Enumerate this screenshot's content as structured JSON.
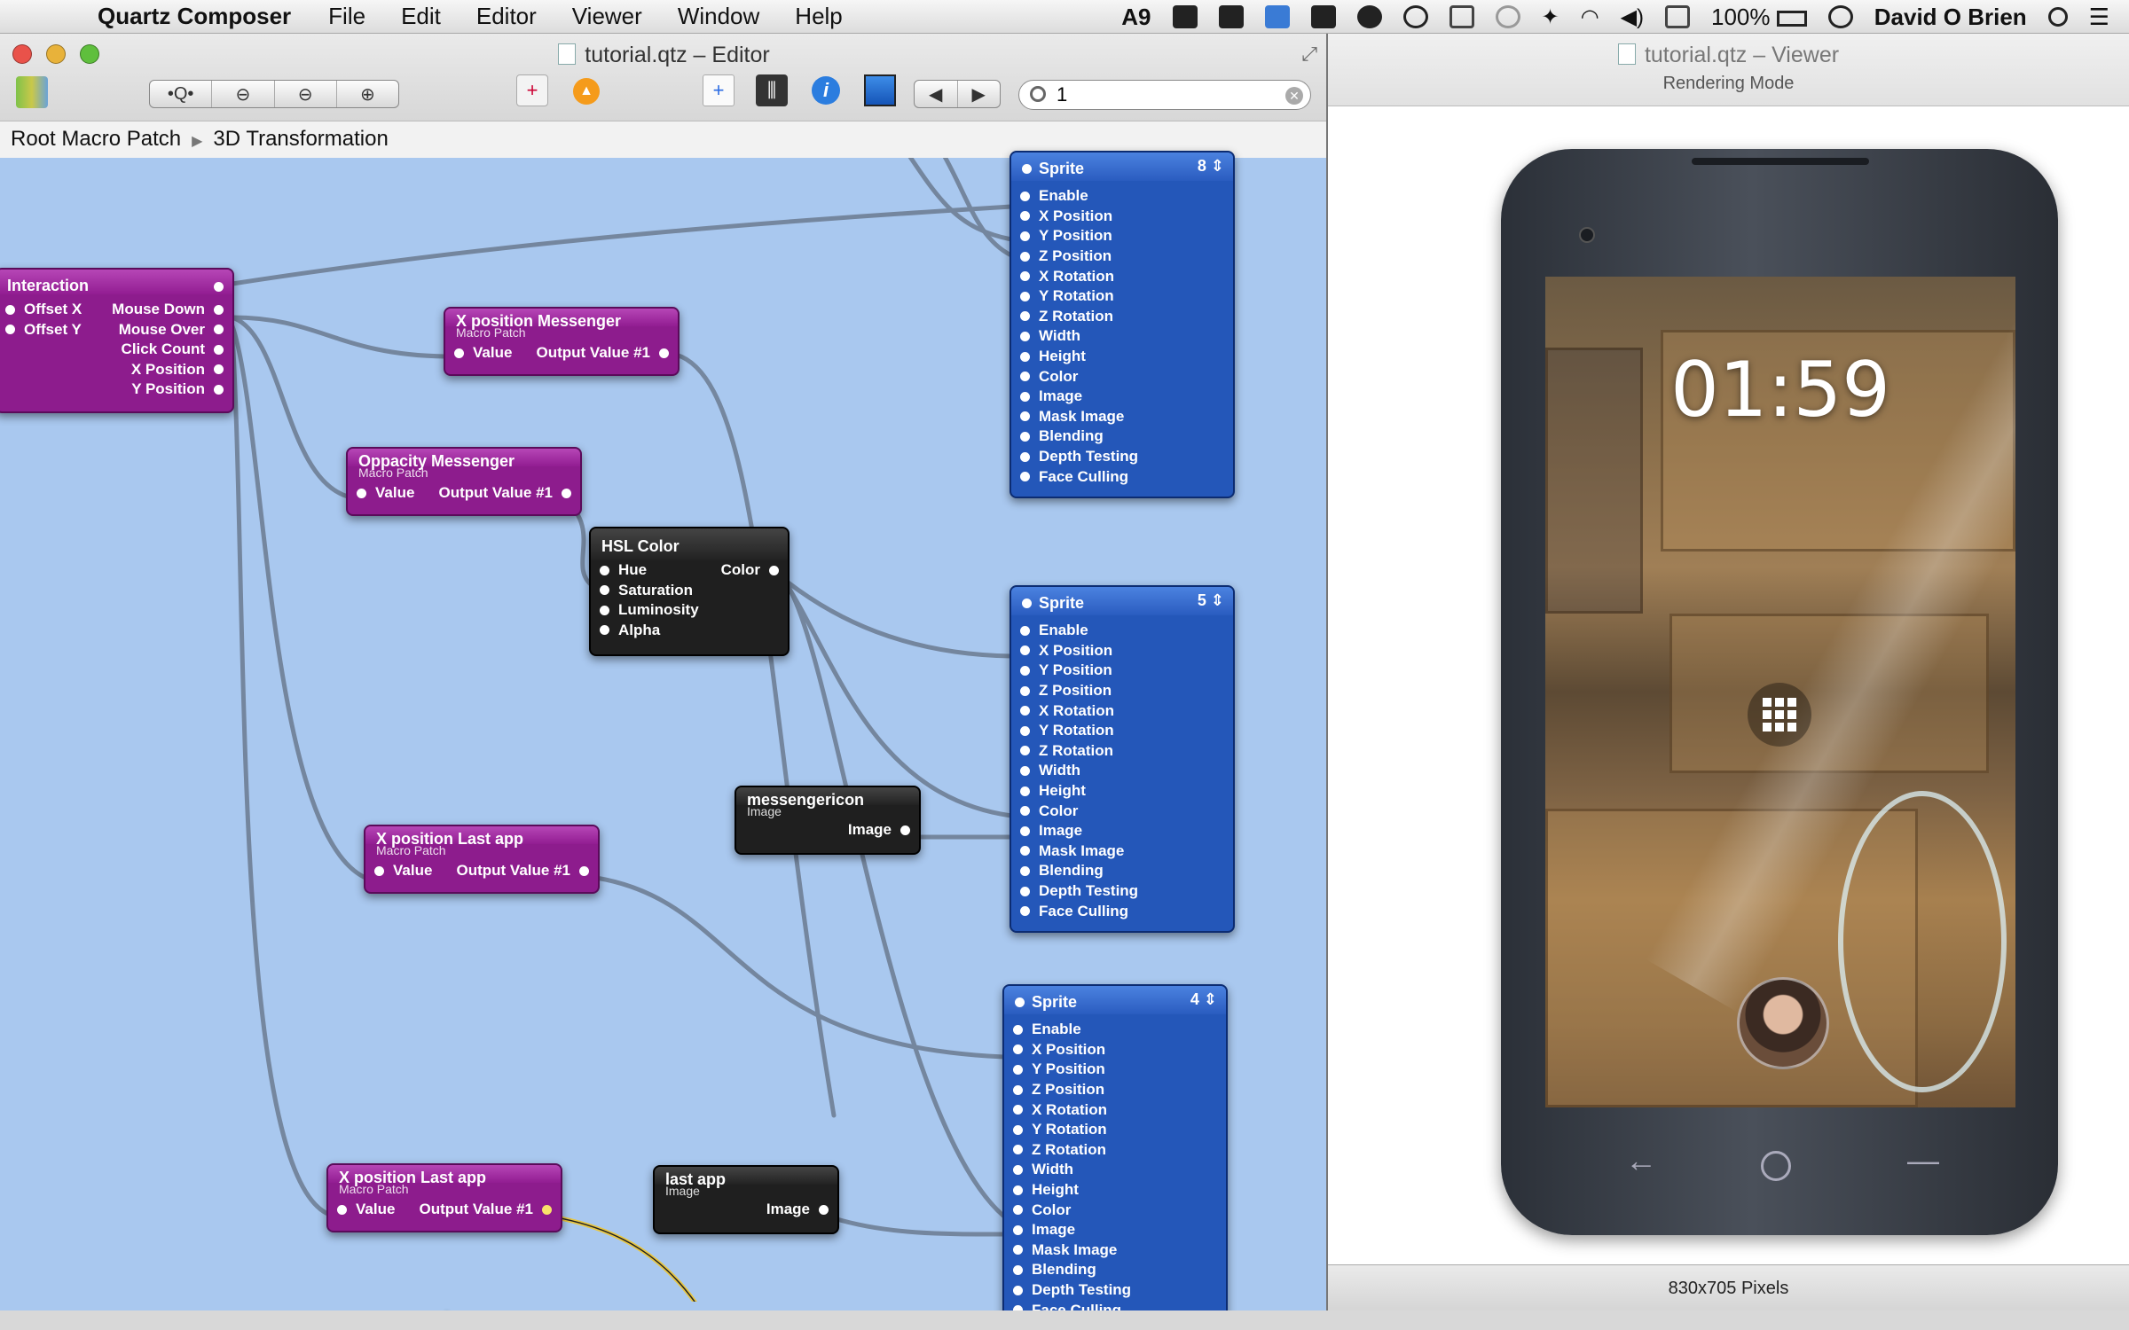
{
  "menubar": {
    "app_name": "Quartz Composer",
    "menus": [
      "File",
      "Edit",
      "Editor",
      "Viewer",
      "Window",
      "Help"
    ],
    "extras_text_1": "9",
    "battery": "100%",
    "user": "David O Brien"
  },
  "editor": {
    "title": "tutorial.qtz – Editor",
    "search_value": "1",
    "breadcrumb": [
      "Root Macro Patch",
      "3D Transformation"
    ]
  },
  "patches": {
    "interaction": {
      "title": "Interaction",
      "inputs": [
        "Offset X",
        "Offset Y"
      ],
      "outputs": [
        "Mouse Down",
        "Mouse Over",
        "Click Count",
        "X Position",
        "Y Position"
      ]
    },
    "xpos_messenger": {
      "title": "X position  Messenger",
      "subtitle": "Macro Patch",
      "input": "Value",
      "output": "Output Value #1"
    },
    "opacity_messenger": {
      "title": "Oppacity  Messenger",
      "subtitle": "Macro Patch",
      "input": "Value",
      "output": "Output Value #1"
    },
    "hsl_color": {
      "title": "HSL Color",
      "inputs": [
        "Hue",
        "Saturation",
        "Luminosity",
        "Alpha"
      ],
      "output": "Color"
    },
    "messenger_icon": {
      "title": "messengericon",
      "subtitle": "Image",
      "output": "Image"
    },
    "xpos_lastapp_1": {
      "title": "X position Last app",
      "subtitle": "Macro Patch",
      "input": "Value",
      "output": "Output Value #1"
    },
    "xpos_lastapp_2": {
      "title": "X position Last app",
      "subtitle": "Macro Patch",
      "input": "Value",
      "output": "Output Value #1"
    },
    "last_app": {
      "title": "last app",
      "subtitle": "Image",
      "output": "Image"
    },
    "sprite_ports": [
      "Enable",
      "X Position",
      "Y Position",
      "Z Position",
      "X Rotation",
      "Y Rotation",
      "Z Rotation",
      "Width",
      "Height",
      "Color",
      "Image",
      "Mask Image",
      "Blending",
      "Depth Testing",
      "Face Culling"
    ],
    "sprites": [
      {
        "title": "Sprite",
        "layer": "8"
      },
      {
        "title": "Sprite",
        "layer": "5"
      },
      {
        "title": "Sprite",
        "layer": "4"
      }
    ]
  },
  "viewer": {
    "title": "tutorial.qtz – Viewer",
    "mode": "Rendering Mode",
    "status": "830x705 Pixels",
    "clock": "01:59"
  },
  "colors": {
    "canvas": "#a9c8ef",
    "macro_patch": "#8d1c8d",
    "sprite_patch": "#2457b9",
    "image_patch": "#1f1f1f"
  }
}
